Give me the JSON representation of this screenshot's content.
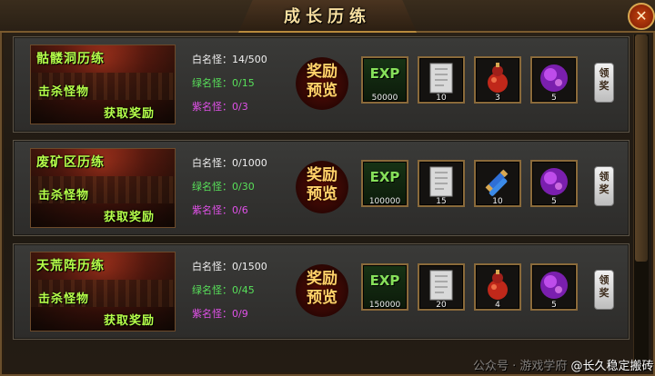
{
  "window": {
    "title": "成长历练",
    "close_glyph": "✕"
  },
  "claim_label": "领\n奖",
  "preview_label": "奖励\n预览",
  "rows": [
    {
      "banner": {
        "name": "骷髅洞历练",
        "kill": "击杀怪物",
        "reward": "获取奖励"
      },
      "white": "白名怪：14/500",
      "green": "绿名怪：0/15",
      "purple": "紫名怪：0/3",
      "rewards": [
        {
          "type": "exp",
          "label": "EXP",
          "count": "50000",
          "icon": "exp-icon"
        },
        {
          "type": "item",
          "count": "10",
          "icon": "scroll-icon"
        },
        {
          "type": "item",
          "count": "3",
          "icon": "gourd-potion-icon"
        },
        {
          "type": "item",
          "count": "5",
          "icon": "purple-orb-icon"
        }
      ]
    },
    {
      "banner": {
        "name": "废矿区历练",
        "kill": "击杀怪物",
        "reward": "获取奖励"
      },
      "white": "白名怪：0/1000",
      "green": "绿名怪：0/30",
      "purple": "紫名怪：0/6",
      "rewards": [
        {
          "type": "exp",
          "label": "EXP",
          "count": "100000",
          "icon": "exp-icon"
        },
        {
          "type": "item",
          "count": "15",
          "icon": "scroll-icon"
        },
        {
          "type": "item",
          "count": "10",
          "icon": "rune-tube-icon"
        },
        {
          "type": "item",
          "count": "5",
          "icon": "purple-orb-icon"
        }
      ]
    },
    {
      "banner": {
        "name": "天荒阵历练",
        "kill": "击杀怪物",
        "reward": "获取奖励"
      },
      "white": "白名怪：0/1500",
      "green": "绿名怪：0/45",
      "purple": "紫名怪：0/9",
      "rewards": [
        {
          "type": "exp",
          "label": "EXP",
          "count": "150000",
          "icon": "exp-icon"
        },
        {
          "type": "item",
          "count": "20",
          "icon": "scroll-icon"
        },
        {
          "type": "item",
          "count": "4",
          "icon": "gourd-potion-icon"
        },
        {
          "type": "item",
          "count": "5",
          "icon": "purple-orb-icon"
        }
      ]
    }
  ],
  "watermark": {
    "left": "公众号 · 游戏学府",
    "right": "@长久稳定搬砖"
  }
}
